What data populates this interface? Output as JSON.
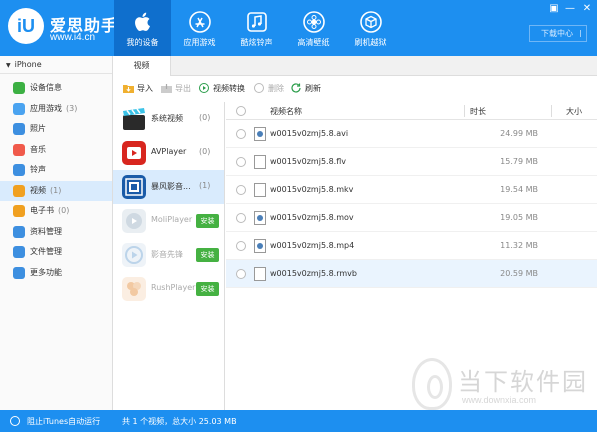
{
  "brand": {
    "logo_text": "iU",
    "name": "爱思助手",
    "url": "www.i4.cn"
  },
  "nav": [
    {
      "label": "我的设备",
      "icon": "apple-icon"
    },
    {
      "label": "应用游戏",
      "icon": "app-store-icon"
    },
    {
      "label": "酷炫铃声",
      "icon": "music-note-icon"
    },
    {
      "label": "高清壁纸",
      "icon": "flower-icon"
    },
    {
      "label": "刷机越狱",
      "icon": "box-icon"
    }
  ],
  "window_controls": [
    "▣",
    "—",
    "✕"
  ],
  "download_center": "下载中心",
  "device": {
    "name": "iPhone"
  },
  "sidebar": [
    {
      "label": "设备信息",
      "count": "",
      "color": "#3cb043"
    },
    {
      "label": "应用游戏",
      "count": "(3)",
      "color": "#4aa3f0"
    },
    {
      "label": "照片",
      "count": "",
      "color": "#3d8fe0"
    },
    {
      "label": "音乐",
      "count": "",
      "color": "#f05a4b"
    },
    {
      "label": "铃声",
      "count": "",
      "color": "#3d8fe0"
    },
    {
      "label": "视频",
      "count": "(1)",
      "color": "#f0a020"
    },
    {
      "label": "电子书",
      "count": "(0)",
      "color": "#f0a020"
    },
    {
      "label": "资料管理",
      "count": "",
      "color": "#3d8fe0"
    },
    {
      "label": "文件管理",
      "count": "",
      "color": "#3d8fe0"
    },
    {
      "label": "更多功能",
      "count": "",
      "color": "#3d8fe0"
    }
  ],
  "content_tab": "视频",
  "toolbar": {
    "import": "导入",
    "export": "导出",
    "convert": "视频转换",
    "delete": "删除",
    "refresh": "刷新"
  },
  "players": [
    {
      "name": "系统视频",
      "count": "(0)",
      "install": ""
    },
    {
      "name": "AVPlayer",
      "count": "(0)",
      "install": ""
    },
    {
      "name": "暴风影音...",
      "count": "(1)",
      "install": ""
    },
    {
      "name": "MoliPlayer",
      "count": "",
      "install": "安装"
    },
    {
      "name": "影音先锋",
      "count": "",
      "install": "安装"
    },
    {
      "name": "RushPlayer",
      "count": "",
      "install": "安装"
    }
  ],
  "table": {
    "columns": {
      "name": "视频名称",
      "duration": "时长",
      "size": "大小"
    },
    "rows": [
      {
        "name": "w0015v0zmj5.8.avi",
        "size": "24.99 MB"
      },
      {
        "name": "w0015v0zmj5.8.flv",
        "size": "15.79 MB"
      },
      {
        "name": "w0015v0zmj5.8.mkv",
        "size": "19.54 MB"
      },
      {
        "name": "w0015v0zmj5.8.mov",
        "size": "19.05 MB"
      },
      {
        "name": "w0015v0zmj5.8.mp4",
        "size": "11.32 MB"
      },
      {
        "name": "w0015v0zmj5.8.rmvb",
        "size": "20.59 MB"
      }
    ]
  },
  "status": {
    "itunes": "阻止iTunes自动运行",
    "summary": "共 1 个视频，总大小 25.03 MB"
  },
  "watermark": {
    "text": "当下软件园",
    "url": "www.downxia.com"
  }
}
